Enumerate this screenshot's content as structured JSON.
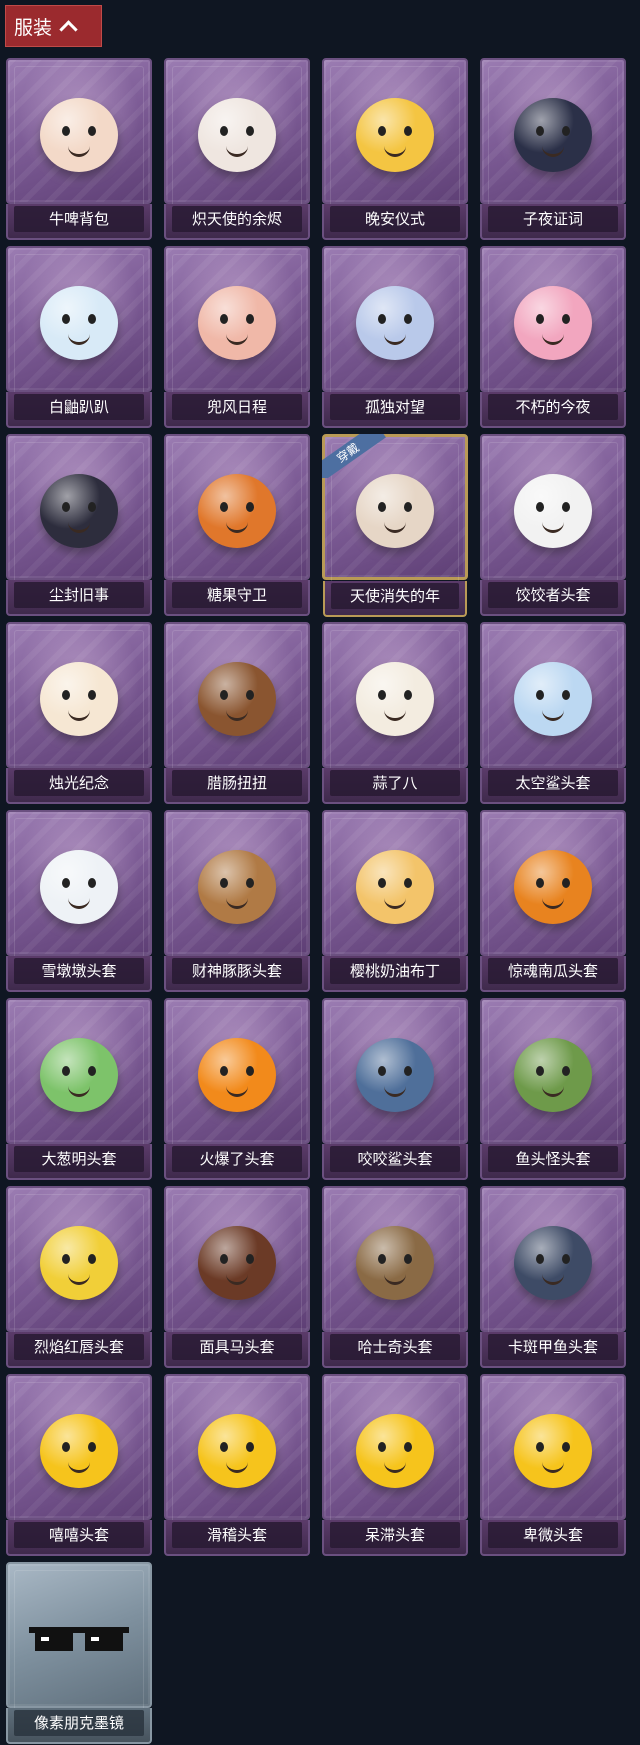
{
  "header": {
    "title": "服装"
  },
  "equipped_badge": "穿戴",
  "items": [
    {
      "label": "牛啤背包",
      "icon": "cow-beer-backpack-icon",
      "color": "#f3d9c8"
    },
    {
      "label": "炽天使的余烬",
      "icon": "seraph-doll-icon",
      "color": "#efe6e0"
    },
    {
      "label": "晚安仪式",
      "icon": "pig-pajama-icon",
      "color": "#f4c542"
    },
    {
      "label": "子夜证词",
      "icon": "owl-figure-icon",
      "color": "#2b3048"
    },
    {
      "label": "白鼬趴趴",
      "icon": "ermine-plush-icon",
      "color": "#d8eaf7"
    },
    {
      "label": "兜风日程",
      "icon": "cap-pig-figure-icon",
      "color": "#f0b8a8"
    },
    {
      "label": "孤独对望",
      "icon": "crystal-charm-icon",
      "color": "#b9c9ea"
    },
    {
      "label": "不朽的今夜",
      "icon": "pink-cat-cake-icon",
      "color": "#f2a6bf"
    },
    {
      "label": "尘封旧事",
      "icon": "dark-prince-charm-icon",
      "color": "#2d2d3d"
    },
    {
      "label": "糖果守卫",
      "icon": "pumpkin-scarecrow-icon",
      "color": "#e0772b"
    },
    {
      "label": "天使消失的年",
      "icon": "angel-medallion-icon",
      "color": "#e6d6c6",
      "equipped": true
    },
    {
      "label": "饺饺者头套",
      "icon": "dumpling-head-icon",
      "color": "#f2f2f2"
    },
    {
      "label": "烛光纪念",
      "icon": "candle-head-icon",
      "color": "#f6e7d3"
    },
    {
      "label": "腊肠扭扭",
      "icon": "dachshund-head-icon",
      "color": "#8a5530"
    },
    {
      "label": "蒜了八",
      "icon": "garlic-head-icon",
      "color": "#f3ece0"
    },
    {
      "label": "太空鲨头套",
      "icon": "space-shark-head-icon",
      "color": "#bcd8f2"
    },
    {
      "label": "雪墩墩头套",
      "icon": "snowman-head-icon",
      "color": "#eef2f6"
    },
    {
      "label": "财神豚豚头套",
      "icon": "capybara-head-icon",
      "color": "#b07a45"
    },
    {
      "label": "樱桃奶油布丁",
      "icon": "pudding-head-icon",
      "color": "#f3c46a"
    },
    {
      "label": "惊魂南瓜头套",
      "icon": "pumpkin-head-icon",
      "color": "#e8831f"
    },
    {
      "label": "大葱明头套",
      "icon": "green-onion-head-icon",
      "color": "#7dc36a"
    },
    {
      "label": "火爆了头套",
      "icon": "fire-head-icon",
      "color": "#f28a1b"
    },
    {
      "label": "咬咬鲨头套",
      "icon": "biting-shark-head-icon",
      "color": "#4f6f9a"
    },
    {
      "label": "鱼头怪头套",
      "icon": "fish-monster-head-icon",
      "color": "#6e9a4a"
    },
    {
      "label": "烈焰红唇头套",
      "icon": "pikachu-sunglasses-head-icon",
      "color": "#f1cf38"
    },
    {
      "label": "面具马头套",
      "icon": "horse-mask-head-icon",
      "color": "#6b3a26"
    },
    {
      "label": "哈士奇头套",
      "icon": "husky-sunglasses-head-icon",
      "color": "#8a6a45"
    },
    {
      "label": "卡斑甲鱼头套",
      "icon": "pufferfish-head-icon",
      "color": "#3e4b66"
    },
    {
      "label": "嘻嘻头套",
      "icon": "grin-emoji-head-icon",
      "color": "#f6c41c"
    },
    {
      "label": "滑稽头套",
      "icon": "funny-emoji-head-icon",
      "color": "#f6c41c"
    },
    {
      "label": "呆滞头套",
      "icon": "dazed-emoji-head-icon",
      "color": "#f6c41c"
    },
    {
      "label": "卑微头套",
      "icon": "humble-emoji-head-icon",
      "color": "#f6c41c"
    },
    {
      "label": "像素朋克墨镜",
      "icon": "pixel-sunglasses-icon",
      "color": "#111111",
      "gray": true
    }
  ]
}
